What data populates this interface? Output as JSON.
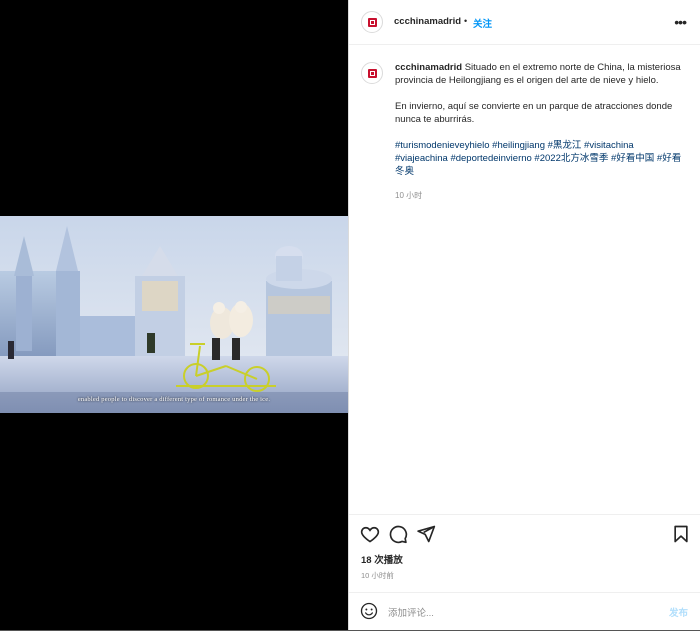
{
  "post": {
    "username": "ccchinamadrid",
    "follow_label": "关注",
    "separator": "•",
    "more_icon": "more-options-icon"
  },
  "video": {
    "subtitle": "enabled people to discover a different type of romance under the ice."
  },
  "caption": {
    "username": "ccchinamadrid",
    "text_1": " Situado en el extremo norte de China, la misteriosa provincia de Heilongjiang es el origen del arte de nieve y hielo.",
    "text_2": "En invierno, aquí se convierte en un parque de atracciones donde nunca te aburrirás.",
    "hashtags": "#turismodenieveyhielo #heilingjiang #黑龙江 #visitachina #viajeachina #deportedeinvierno #2022北方冰雪季 #好看中国 #好看冬奥",
    "time": "10 小时"
  },
  "actions": {
    "like_icon": "heart-icon",
    "comment_icon": "comment-icon",
    "share_icon": "share-icon",
    "save_icon": "bookmark-icon"
  },
  "stats": {
    "views": "18 次播放",
    "time": "10 小时前"
  },
  "comment": {
    "emoji_icon": "emoji-icon",
    "placeholder": "添加评论...",
    "post_label": "发布"
  },
  "colors": {
    "accent": "#0095f6",
    "brand_red": "#c8102e",
    "hashtag": "#00376b"
  }
}
